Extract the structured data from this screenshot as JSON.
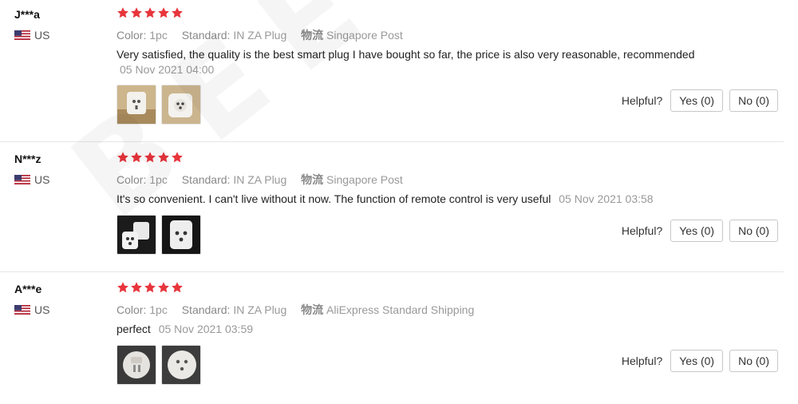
{
  "helpful_label": "Helpful?",
  "attr_labels": {
    "color": "Color:",
    "standard": "Standard:",
    "shipping": "物流"
  },
  "colors": {
    "star": "#e8353c",
    "text": "#222222",
    "muted": "#999999"
  },
  "reviews": [
    {
      "user": "J***a",
      "country": "US",
      "rating": 5,
      "color": "1pc",
      "standard": "IN ZA Plug",
      "shipping": "Singapore Post",
      "text": "Very satisfied, the quality is the best smart plug I have bought so far, the price is also very reasonable, recommended",
      "date": "05 Nov 2021 04:00",
      "photos": 2,
      "yes": "Yes (0)",
      "no": "No (0)"
    },
    {
      "user": "N***z",
      "country": "US",
      "rating": 5,
      "color": "1pc",
      "standard": "IN ZA Plug",
      "shipping": "Singapore Post",
      "text": "It's so convenient. I can't live without it now. The function of remote control is very useful",
      "date": "05 Nov 2021 03:58",
      "photos": 2,
      "yes": "Yes (0)",
      "no": "No (0)"
    },
    {
      "user": "A***e",
      "country": "US",
      "rating": 5,
      "color": "1pc",
      "standard": "IN ZA Plug",
      "shipping": "AliExpress Standard Shipping",
      "text": "perfect",
      "date": "05 Nov 2021 03:59",
      "photos": 2,
      "yes": "Yes (0)",
      "no": "No (0)"
    }
  ]
}
